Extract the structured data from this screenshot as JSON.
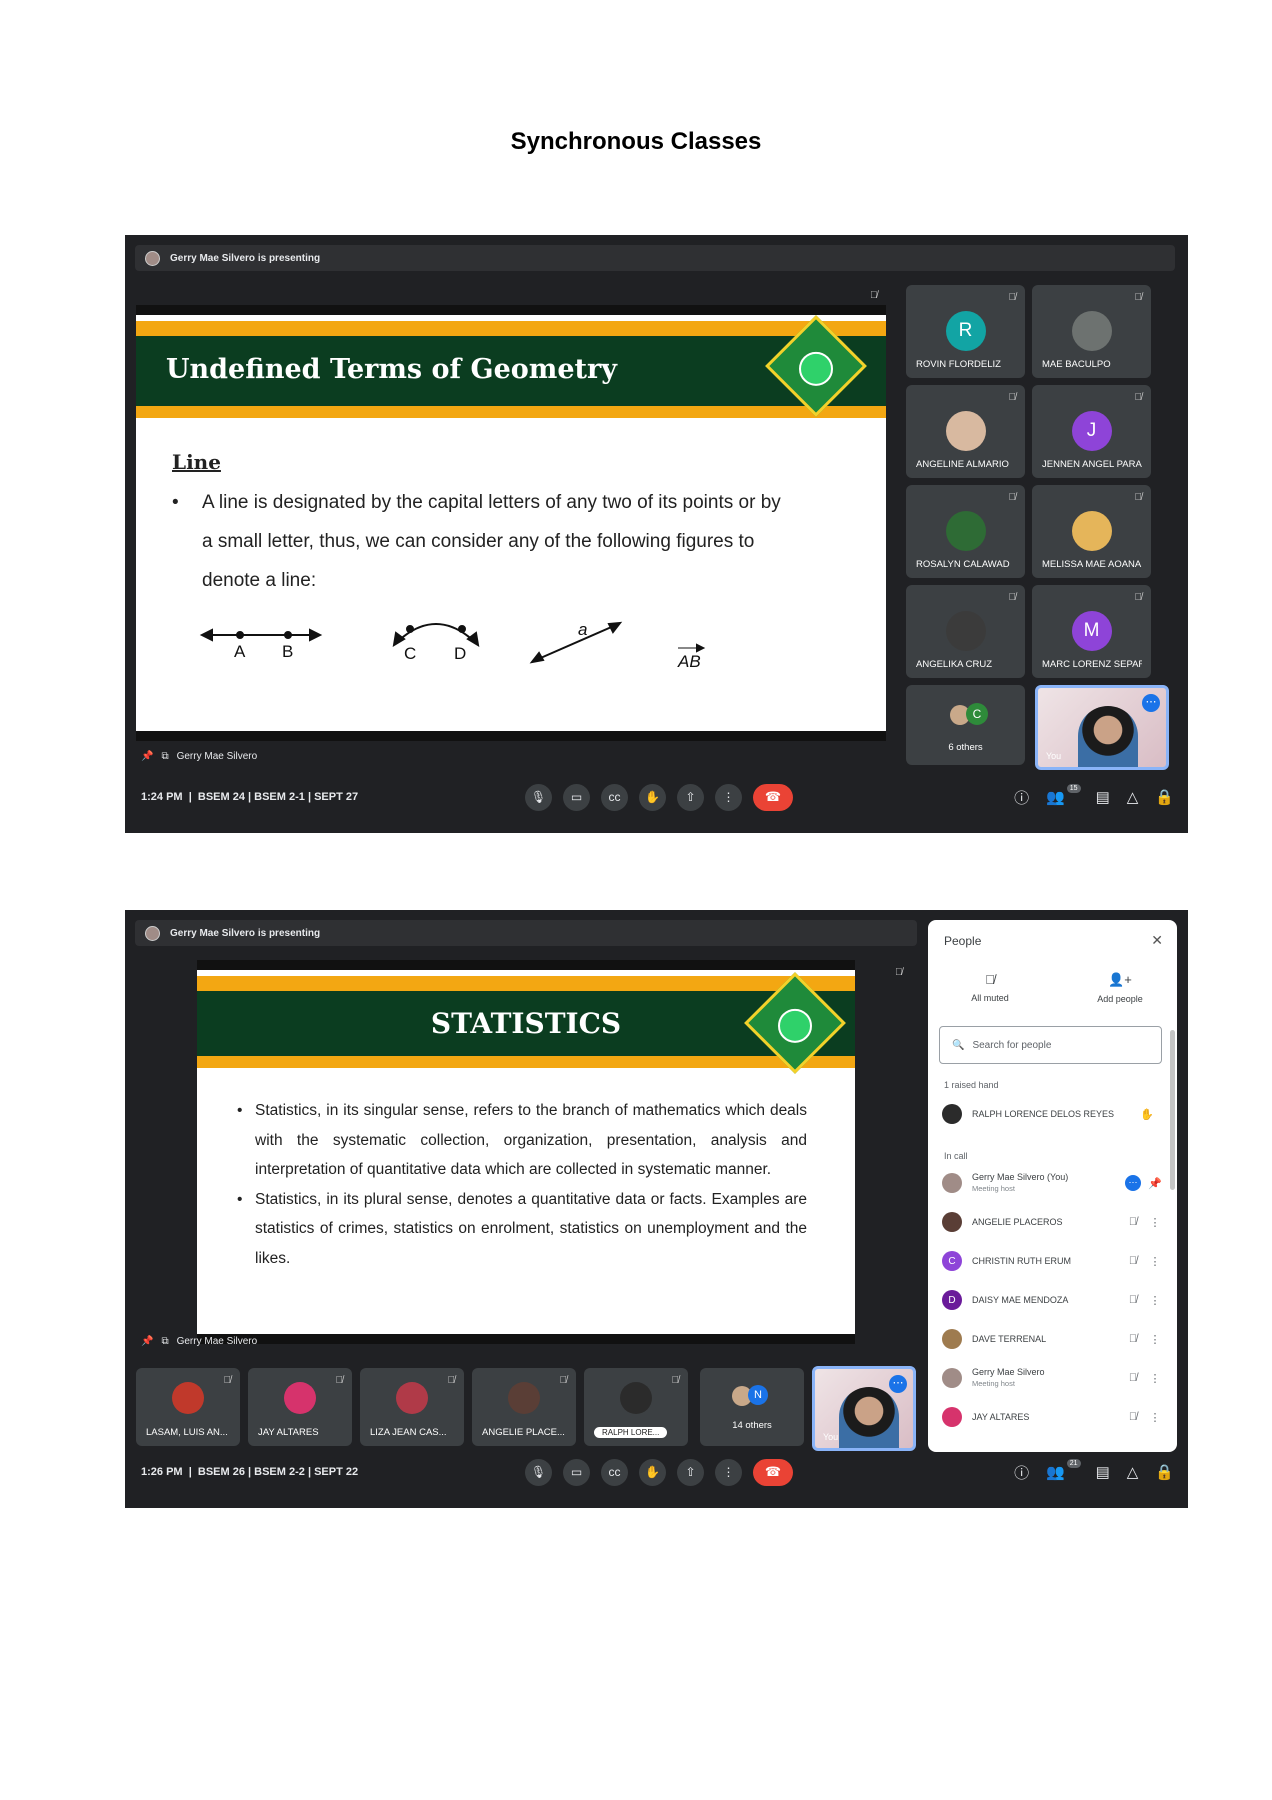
{
  "document": {
    "title": "Synchronous Classes"
  },
  "shot1": {
    "presenting": "Gerry Mae Silvero is presenting",
    "slide": {
      "title": "Undefined Terms of Geometry",
      "heading": "Line",
      "bullet": "A line is designated by the capital letters of any two of its points or by a small letter, thus, we can consider any of the following figures to denote a line:",
      "figure_labels": [
        "A",
        "B",
        "C",
        "D",
        "a",
        "AB"
      ]
    },
    "pinned_name": "Gerry Mae Silvero",
    "tiles": [
      {
        "name": "ROVIN FLORDELIZ",
        "initial": "R",
        "color": "#12a4a4"
      },
      {
        "name": "MAE BACULPO",
        "initial": "",
        "color": "#6d7270"
      },
      {
        "name": "ANGELINE ALMARIO",
        "initial": "",
        "color": "#d8b9a0"
      },
      {
        "name": "JENNEN ANGEL PARA...",
        "initial": "J",
        "color": "#8e44d8"
      },
      {
        "name": "ROSALYN CALAWAD",
        "initial": "",
        "color": "#2e6b35"
      },
      {
        "name": "MELISSA MAE AOANAN",
        "initial": "",
        "color": "#e5b55a"
      },
      {
        "name": "ANGELIKA CRUZ",
        "initial": "",
        "color": "#3b3b3b"
      },
      {
        "name": "MARC LORENZ SEPARA",
        "initial": "M",
        "color": "#8e44d8"
      }
    ],
    "others": {
      "label": "6 others",
      "initial": "C"
    },
    "self_label": "You",
    "time": "1:24 PM",
    "meeting": "BSEM 24 | BSEM 2-1 | SEPT 27",
    "people_count": "15"
  },
  "shot2": {
    "presenting": "Gerry Mae Silvero is presenting",
    "slide": {
      "title": "STATISTICS",
      "bullets": [
        "Statistics, in its singular sense, refers to the branch of mathematics which deals with the systematic collection, organization, presentation, analysis and interpretation of quantitative data which are collected in systematic manner.",
        "Statistics, in its plural sense, denotes a quantitative data or facts. Examples are statistics of crimes, statistics on enrolment, statistics on unemployment and the likes."
      ]
    },
    "pinned_name": "Gerry Mae Silvero",
    "tiles": [
      {
        "name": "LASAM, LUIS AN...",
        "color": "#c0392b"
      },
      {
        "name": "JAY ALTARES",
        "color": "#d6336c"
      },
      {
        "name": "LIZA JEAN CAS...",
        "color": "#b03a48"
      },
      {
        "name": "ANGELIE PLACE...",
        "color": "#5a3e36"
      },
      {
        "name": "RALPH LORE...",
        "color": "#2b2b2b"
      }
    ],
    "others": {
      "label": "14 others",
      "initial": "N"
    },
    "self_label": "You",
    "time": "1:26 PM",
    "meeting": "BSEM 26 | BSEM 2-2 | SEPT 22",
    "people_count": "21",
    "people_panel": {
      "title": "People",
      "all_muted": "All muted",
      "add_people": "Add people",
      "search_placeholder": "Search for people",
      "raised_label": "1 raised hand",
      "raised": {
        "name": "RALPH LORENCE DELOS REYES"
      },
      "in_call_label": "In call",
      "members": [
        {
          "name": "Gerry Mae Silvero (You)",
          "sub": "Meeting host",
          "initial": "",
          "color": "#a08c87"
        },
        {
          "name": "ANGELIE PLACEROS",
          "sub": "",
          "initial": "",
          "color": "#5a3e36"
        },
        {
          "name": "CHRISTIN RUTH ERUM",
          "sub": "",
          "initial": "C",
          "color": "#8e44d8"
        },
        {
          "name": "DAISY MAE MENDOZA",
          "sub": "",
          "initial": "D",
          "color": "#6a1b9a"
        },
        {
          "name": "DAVE TERRENAL",
          "sub": "",
          "initial": "",
          "color": "#9e7b4f"
        },
        {
          "name": "Gerry Mae Silvero",
          "sub": "Meeting host",
          "initial": "",
          "color": "#a08c87"
        },
        {
          "name": "JAY ALTARES",
          "sub": "",
          "initial": "",
          "color": "#d6336c"
        }
      ]
    }
  }
}
